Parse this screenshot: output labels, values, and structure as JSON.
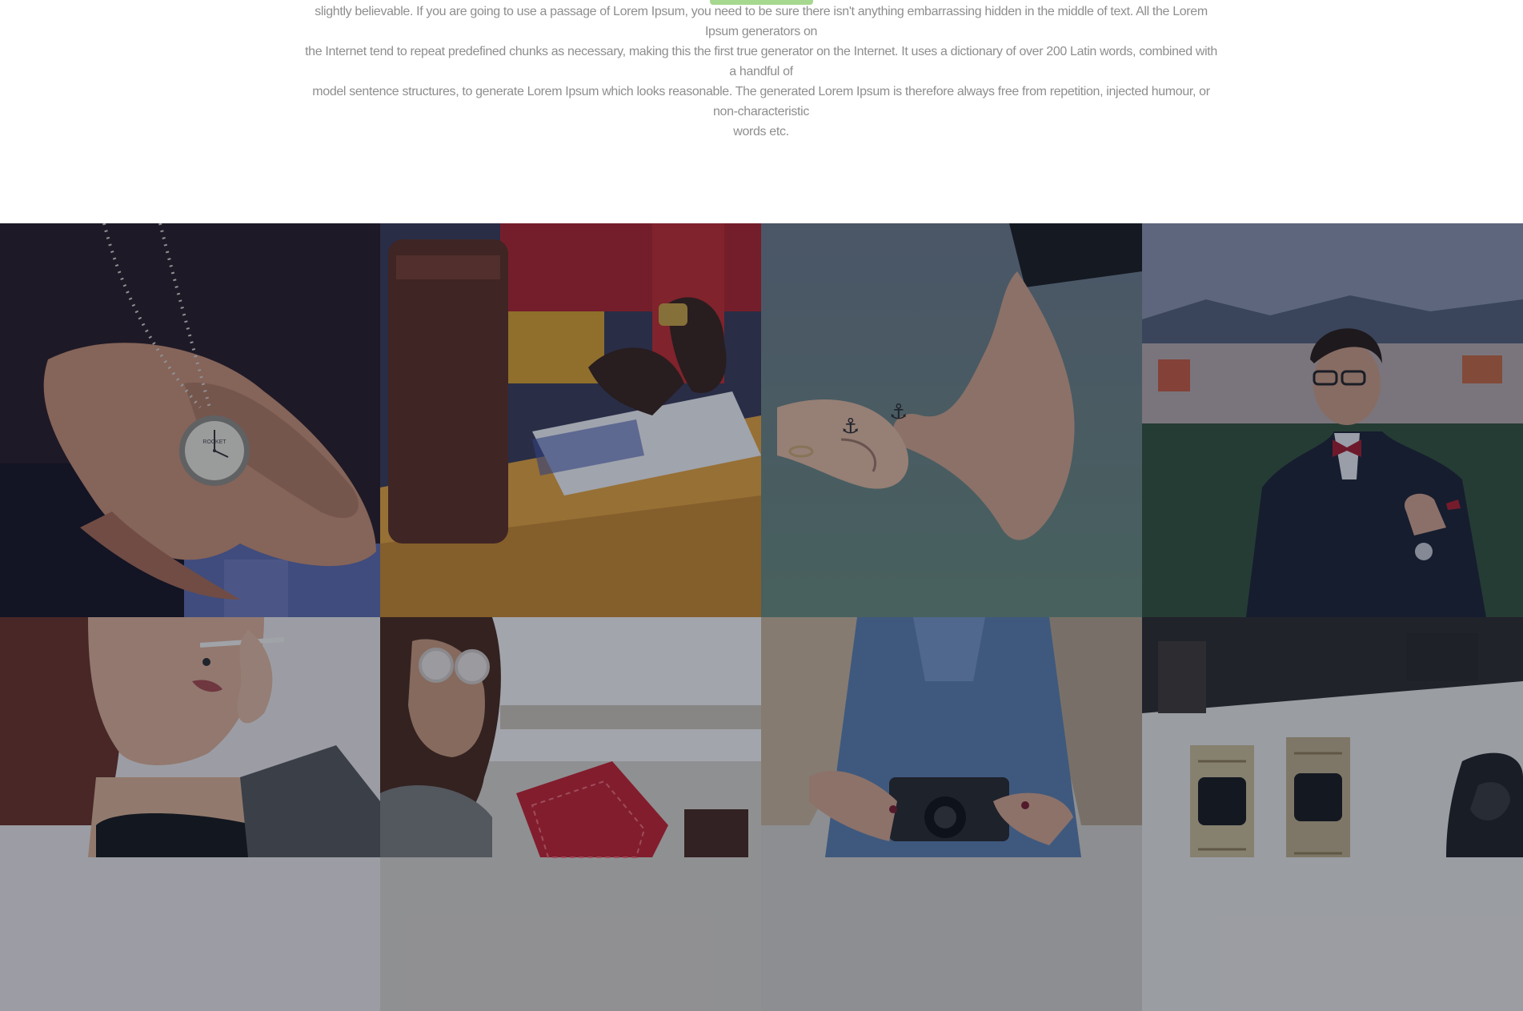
{
  "intro": {
    "lines": [
      "slightly believable. If you are going to use a passage of Lorem Ipsum, you need to be sure there isn't anything embarrassing hidden in the middle of text. All the Lorem Ipsum generators on",
      "the Internet tend to repeat predefined chunks as necessary, making this the first true generator on the Internet. It uses a dictionary of over 200 Latin words, combined with a handful of",
      "model sentence structures, to generate Lorem Ipsum which looks reasonable. The generated Lorem Ipsum is therefore always free from repetition, injected humour, or non-characteristic",
      "words etc."
    ]
  },
  "colors": {
    "accent": "#a6d88f",
    "text": "#8e8e8e",
    "overlay": "rgba(10,20,45,0.35)"
  },
  "gallery": {
    "tiles": [
      {
        "subject": "pocket-watch-in-hands",
        "watch_brand": "ROCKET"
      },
      {
        "subject": "person-writing-at-desk"
      },
      {
        "subject": "tattooed-fingers-holding"
      },
      {
        "subject": "man-in-suit-bow-tie"
      },
      {
        "subject": "woman-smoking"
      },
      {
        "subject": "woman-with-sunglasses"
      },
      {
        "subject": "woman-with-camera"
      },
      {
        "subject": "wristwatches-on-table"
      }
    ]
  }
}
